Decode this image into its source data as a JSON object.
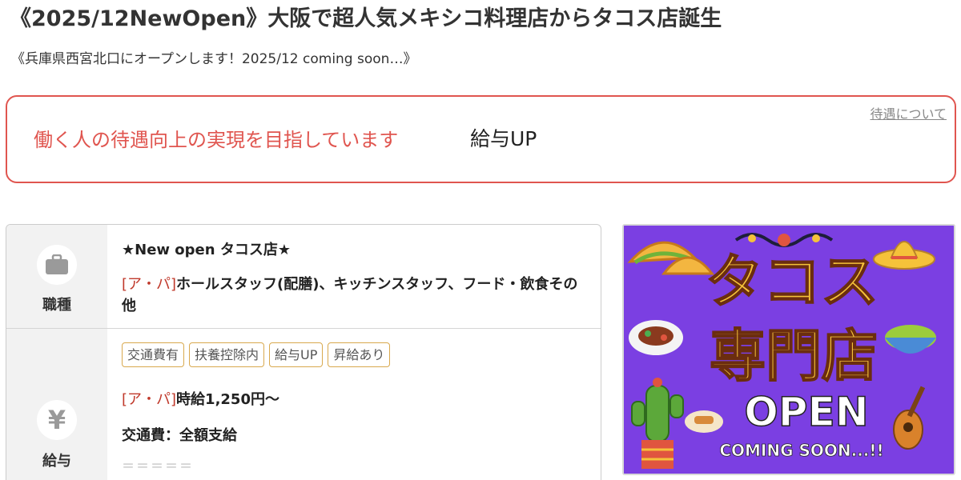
{
  "header": {
    "title": "《2025/12NewOpen》大阪で超人気メキシコ料理店からタコス店誕生",
    "subtitle": "《兵庫県西宮北口にオープンします！2025/12 coming soon…》"
  },
  "notice": {
    "link_label": "待遇について",
    "message": "働く人の待遇向上の実現を目指しています",
    "tag": "給与UP",
    "accent_color": "#e0554f"
  },
  "job": {
    "label": "職種",
    "icon": "briefcase-icon",
    "title": "★New open タコス店★",
    "prefix": "[ア・パ]",
    "description": "ホールスタッフ(配膳)、キッチンスタッフ、フード・飲食その他"
  },
  "salary": {
    "label": "給与",
    "icon": "yen-icon",
    "icon_glyph": "¥",
    "tags": [
      "交通費有",
      "扶養控除内",
      "給与UP",
      "昇給あり"
    ],
    "wage_prefix": "[ア・パ]",
    "wage": "時給1,250円〜",
    "transport": "交通費：全額支給",
    "separator": "＝＝＝＝＝"
  },
  "promo": {
    "line1": "タコス",
    "line2": "専門店",
    "line3": "OPEN",
    "line4": "COMING SOON...!!",
    "background_color": "#7b3fe2",
    "text_color": "#f5c23a"
  }
}
